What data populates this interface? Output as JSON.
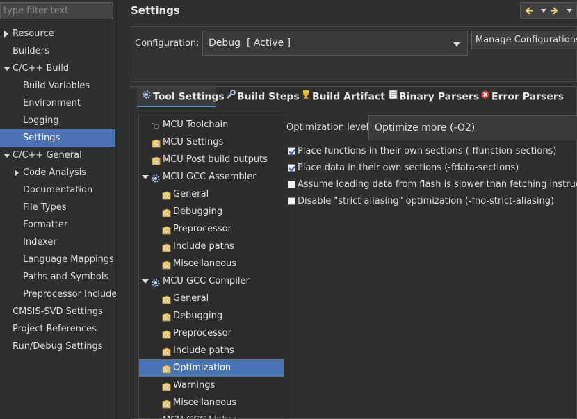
{
  "filter": {
    "placeholder": "type filter text"
  },
  "nav": [
    {
      "label": "Resource",
      "indent": 0,
      "expander": "collapsed",
      "selected": false
    },
    {
      "label": "Builders",
      "indent": 0,
      "expander": "none",
      "selected": false
    },
    {
      "label": "C/C++ Build",
      "indent": 0,
      "expander": "expanded",
      "selected": false
    },
    {
      "label": "Build Variables",
      "indent": 1,
      "expander": "none",
      "selected": false
    },
    {
      "label": "Environment",
      "indent": 1,
      "expander": "none",
      "selected": false
    },
    {
      "label": "Logging",
      "indent": 1,
      "expander": "none",
      "selected": false
    },
    {
      "label": "Settings",
      "indent": 1,
      "expander": "none",
      "selected": true
    },
    {
      "label": "C/C++ General",
      "indent": 0,
      "expander": "expanded",
      "selected": false
    },
    {
      "label": "Code Analysis",
      "indent": 1,
      "expander": "collapsed",
      "selected": false
    },
    {
      "label": "Documentation",
      "indent": 1,
      "expander": "none",
      "selected": false
    },
    {
      "label": "File Types",
      "indent": 1,
      "expander": "none",
      "selected": false
    },
    {
      "label": "Formatter",
      "indent": 1,
      "expander": "none",
      "selected": false
    },
    {
      "label": "Indexer",
      "indent": 1,
      "expander": "none",
      "selected": false
    },
    {
      "label": "Language Mappings",
      "indent": 1,
      "expander": "none",
      "selected": false
    },
    {
      "label": "Paths and Symbols",
      "indent": 1,
      "expander": "none",
      "selected": false
    },
    {
      "label": "Preprocessor Include",
      "indent": 1,
      "expander": "none",
      "selected": false
    },
    {
      "label": "CMSIS-SVD Settings",
      "indent": 0,
      "expander": "none",
      "selected": false
    },
    {
      "label": "Project References",
      "indent": 0,
      "expander": "none",
      "selected": false
    },
    {
      "label": "Run/Debug Settings",
      "indent": 0,
      "expander": "none",
      "selected": false
    }
  ],
  "page_title": "Settings",
  "configuration": {
    "label": "Configuration:",
    "value": "Debug  [ Active ]",
    "manage_label": "Manage Configurations..."
  },
  "tabs": [
    {
      "label": "Tool Settings",
      "icon": "gear-icon",
      "active": true
    },
    {
      "label": "Build Steps",
      "icon": "wrench-icon",
      "active": false
    },
    {
      "label": "Build Artifact",
      "icon": "trophy-icon",
      "active": false
    },
    {
      "label": "Binary Parsers",
      "icon": "binary-icon",
      "active": false
    },
    {
      "label": "Error Parsers",
      "icon": "error-icon",
      "active": false
    }
  ],
  "tool_tree": [
    {
      "label": "MCU Toolchain",
      "level": 0,
      "icon": "toolchain-icon",
      "expander": "none",
      "selected": false
    },
    {
      "label": "MCU Settings",
      "level": 0,
      "icon": "settings-page-icon",
      "expander": "none",
      "selected": false
    },
    {
      "label": "MCU Post build outputs",
      "level": 0,
      "icon": "settings-page-icon",
      "expander": "none",
      "selected": false
    },
    {
      "label": "MCU GCC Assembler",
      "level": 0,
      "icon": "tool-gear-icon",
      "expander": "expanded",
      "selected": false
    },
    {
      "label": "General",
      "level": 1,
      "icon": "settings-page-icon",
      "expander": "none",
      "selected": false
    },
    {
      "label": "Debugging",
      "level": 1,
      "icon": "settings-page-icon",
      "expander": "none",
      "selected": false
    },
    {
      "label": "Preprocessor",
      "level": 1,
      "icon": "settings-page-icon",
      "expander": "none",
      "selected": false
    },
    {
      "label": "Include paths",
      "level": 1,
      "icon": "settings-page-icon",
      "expander": "none",
      "selected": false
    },
    {
      "label": "Miscellaneous",
      "level": 1,
      "icon": "settings-page-icon",
      "expander": "none",
      "selected": false
    },
    {
      "label": "MCU GCC Compiler",
      "level": 0,
      "icon": "tool-gear-icon",
      "expander": "expanded",
      "selected": false
    },
    {
      "label": "General",
      "level": 1,
      "icon": "settings-page-icon",
      "expander": "none",
      "selected": false
    },
    {
      "label": "Debugging",
      "level": 1,
      "icon": "settings-page-icon",
      "expander": "none",
      "selected": false
    },
    {
      "label": "Preprocessor",
      "level": 1,
      "icon": "settings-page-icon",
      "expander": "none",
      "selected": false
    },
    {
      "label": "Include paths",
      "level": 1,
      "icon": "settings-page-icon",
      "expander": "none",
      "selected": false
    },
    {
      "label": "Optimization",
      "level": 1,
      "icon": "settings-page-icon",
      "expander": "none",
      "selected": true
    },
    {
      "label": "Warnings",
      "level": 1,
      "icon": "settings-page-icon",
      "expander": "none",
      "selected": false
    },
    {
      "label": "Miscellaneous",
      "level": 1,
      "icon": "settings-page-icon",
      "expander": "none",
      "selected": false
    },
    {
      "label": "MCU GCC Linker",
      "level": 0,
      "icon": "tool-gear-icon",
      "expander": "expanded",
      "selected": false
    }
  ],
  "optimization": {
    "label": "Optimization level",
    "value": "Optimize more (-O2)"
  },
  "options": [
    {
      "label": "Place functions in their own sections (-ffunction-sections)",
      "checked": true
    },
    {
      "label": "Place data in their own sections (-fdata-sections)",
      "checked": true
    },
    {
      "label": "Assume loading data from flash is slower than fetching instructions",
      "checked": false
    },
    {
      "label": "Disable \"strict aliasing\" optimization (-fno-strict-aliasing)",
      "checked": false
    }
  ],
  "colors": {
    "selection": "#4a73b5",
    "background": "#2f2f2f",
    "nav_arrow": "#f0d070"
  }
}
